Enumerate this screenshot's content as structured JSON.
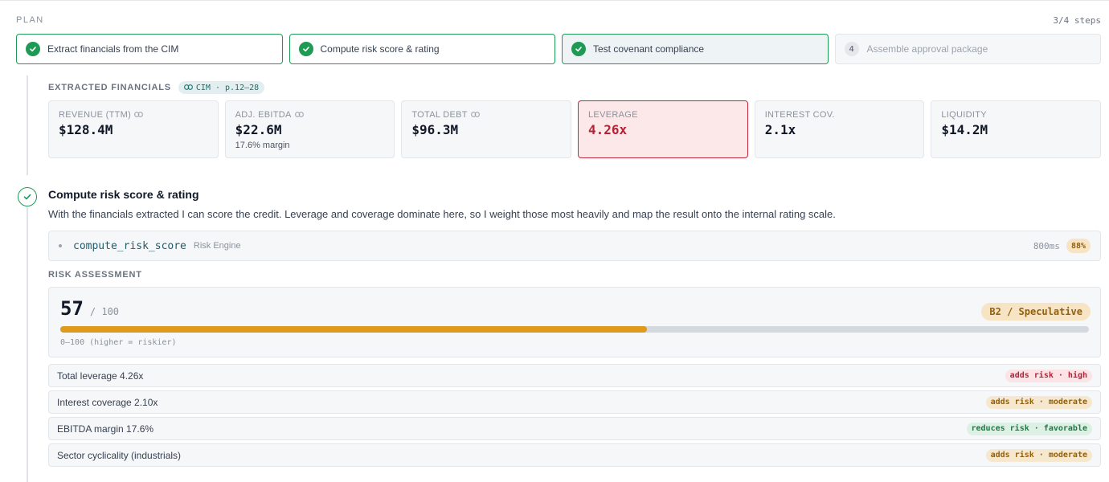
{
  "plan": {
    "label": "PLAN",
    "count": "3/4 steps",
    "steps": [
      {
        "label": "Extract financials from the CIM",
        "status": "done"
      },
      {
        "label": "Compute risk score & rating",
        "status": "done"
      },
      {
        "label": "Test covenant compliance",
        "status": "done"
      },
      {
        "number": "4",
        "label": "Assemble approval package",
        "status": "pending"
      }
    ]
  },
  "extracted": {
    "title": "EXTRACTED FINANCIALS",
    "source": "CIM · p.12–28",
    "metrics": [
      {
        "label": "REVENUE (TTM)",
        "value": "$128.4M",
        "linked": true
      },
      {
        "label": "ADJ. EBITDA",
        "value": "$22.6M",
        "sub": "17.6% margin",
        "linked": true
      },
      {
        "label": "TOTAL DEBT",
        "value": "$96.3M",
        "linked": true
      },
      {
        "label": "LEVERAGE",
        "value": "4.26x",
        "alert": true
      },
      {
        "label": "INTEREST COV.",
        "value": "2.1x"
      },
      {
        "label": "LIQUIDITY",
        "value": "$14.2M"
      }
    ]
  },
  "step2": {
    "title": "Compute risk score & rating",
    "description": "With the financials extracted I can score the credit. Leverage and coverage dominate here, so I weight those most heavily and map the result onto the internal rating scale.",
    "tool": {
      "name": "compute_risk_score",
      "engine": "Risk Engine",
      "duration": "800ms",
      "confidence": "88%"
    }
  },
  "risk": {
    "label": "RISK ASSESSMENT",
    "score": "57",
    "max": "/ 100",
    "score_fraction": 0.57,
    "rating": "B2 / Speculative",
    "scale_note": "0–100 (higher = riskier)",
    "factors": [
      {
        "text": "Total leverage 4.26x",
        "tag": "adds risk · high",
        "level": "high"
      },
      {
        "text": "Interest coverage 2.10x",
        "tag": "adds risk · moderate",
        "level": "moderate"
      },
      {
        "text": "EBITDA margin 17.6%",
        "tag": "reduces risk · favorable",
        "level": "favorable"
      },
      {
        "text": "Sector cyclicality (industrials)",
        "tag": "adds risk · moderate",
        "level": "moderate"
      }
    ]
  },
  "colors": {
    "success": "#1f9a55",
    "alert": "#b42335",
    "warning": "#dd9a1c"
  }
}
